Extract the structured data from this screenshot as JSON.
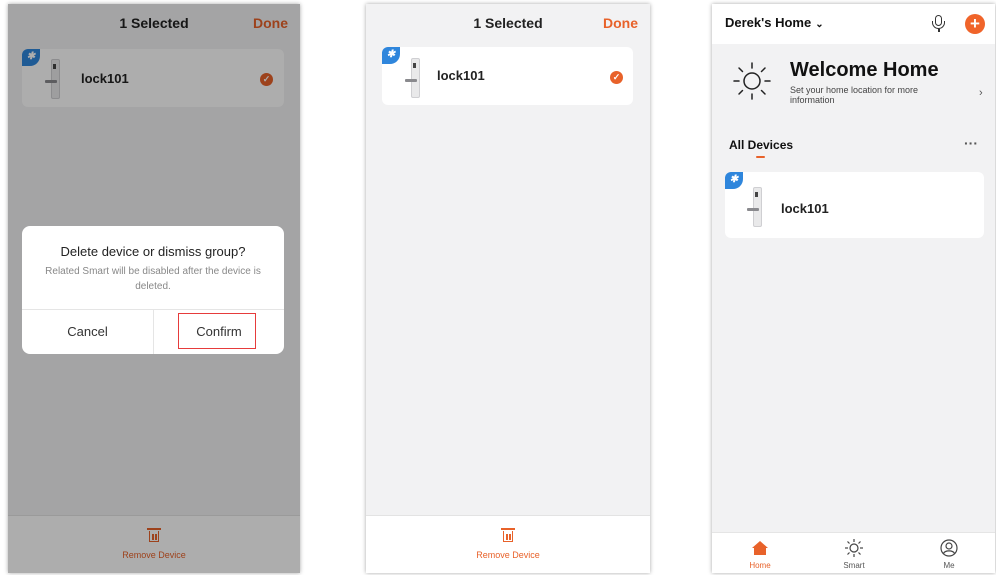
{
  "screen1": {
    "header": {
      "title": "1  Selected",
      "done": "Done"
    },
    "device": {
      "name": "lock101",
      "badge_icon": "bluetooth-icon",
      "selected": true
    },
    "dialog": {
      "title": "Delete device or dismiss group?",
      "message": "Related Smart will be disabled after the device is deleted.",
      "cancel": "Cancel",
      "confirm": "Confirm"
    },
    "bottom": {
      "remove_label": "Remove Device",
      "icon": "trash-icon"
    }
  },
  "screen2": {
    "header": {
      "title": "1  Selected",
      "done": "Done"
    },
    "device": {
      "name": "lock101",
      "badge_icon": "bluetooth-icon",
      "selected": true
    },
    "bottom": {
      "remove_label": "Remove Device",
      "icon": "trash-icon"
    }
  },
  "screen3": {
    "header": {
      "home_name": "Derek's Home"
    },
    "welcome": {
      "title": "Welcome Home",
      "subtitle": "Set your home location for more information"
    },
    "section": {
      "title": "All Devices"
    },
    "device": {
      "name": "lock101",
      "badge_icon": "bluetooth-icon"
    },
    "tabs": [
      {
        "label": "Home",
        "icon": "home-icon",
        "active": true
      },
      {
        "label": "Smart",
        "icon": "sun-icon",
        "active": false
      },
      {
        "label": "Me",
        "icon": "user-icon",
        "active": false
      }
    ]
  },
  "colors": {
    "accent": "#e8622a",
    "bluetooth": "#2f86dc",
    "highlight": "#e63b3b"
  }
}
